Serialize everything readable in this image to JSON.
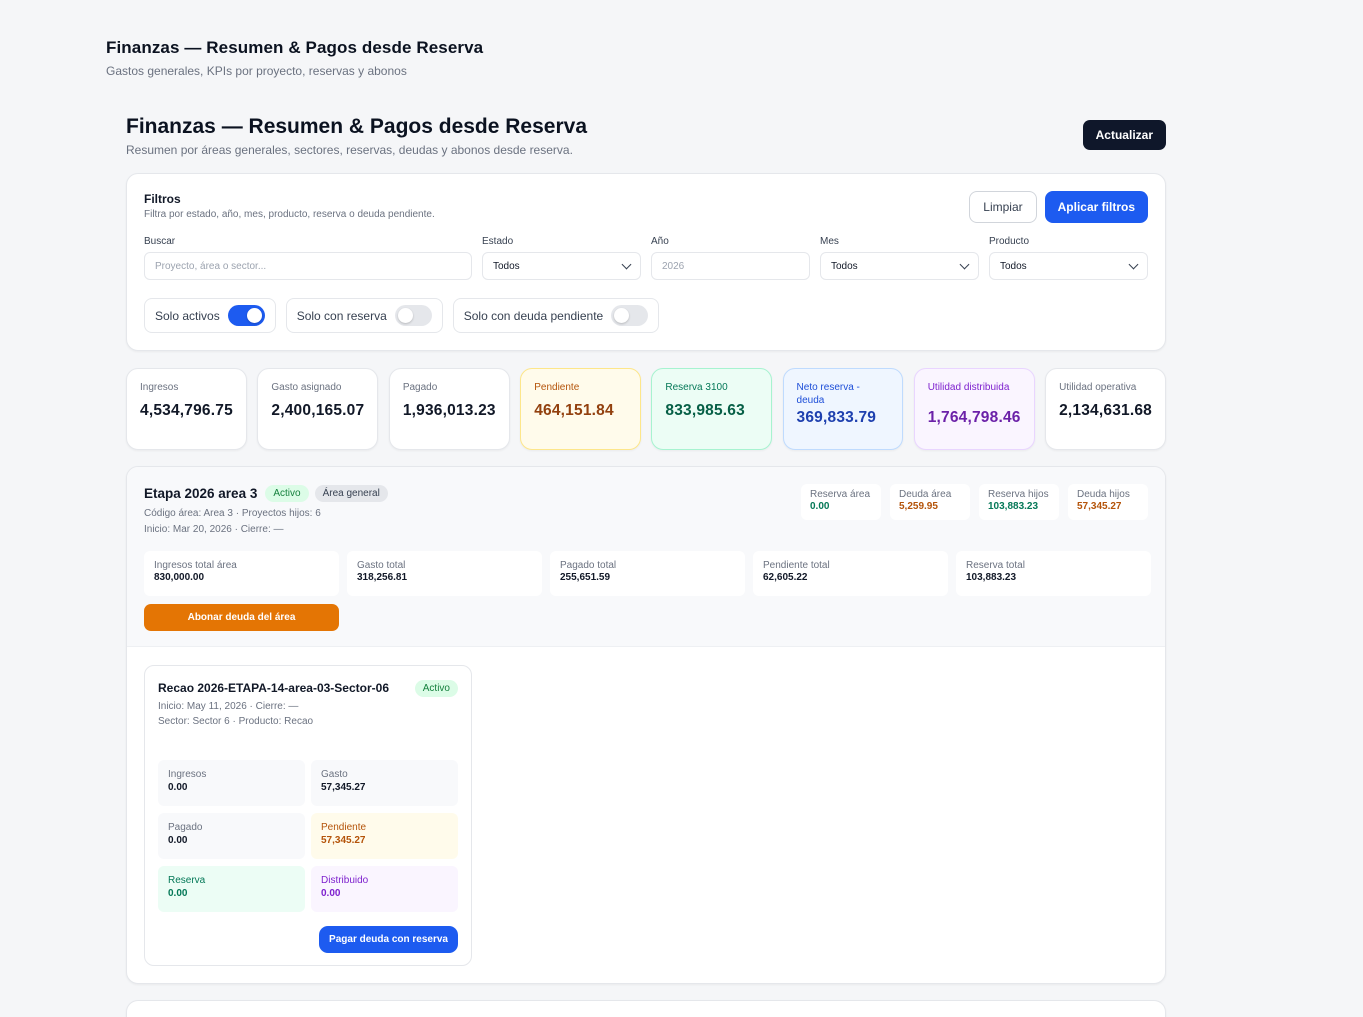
{
  "page": {
    "title": "Finanzas — Resumen & Pagos desde Reserva",
    "subtitle": "Gastos generales, KPIs por proyecto, reservas y abonos"
  },
  "main": {
    "title": "Finanzas — Resumen & Pagos desde Reserva",
    "subtitle": "Resumen por áreas generales, sectores, reservas, deudas y abonos desde reserva.",
    "refresh_label": "Actualizar"
  },
  "filters": {
    "title": "Filtros",
    "subtitle": "Filtra por estado, año, mes, producto, reserva o deuda pendiente.",
    "clear_label": "Limpiar",
    "apply_label": "Aplicar filtros",
    "search": {
      "label": "Buscar",
      "placeholder": "Proyecto, área o sector..."
    },
    "estado": {
      "label": "Estado",
      "value": "Todos"
    },
    "anio": {
      "label": "Año",
      "placeholder": "2026"
    },
    "mes": {
      "label": "Mes",
      "value": "Todos"
    },
    "producto": {
      "label": "Producto",
      "value": "Todos"
    },
    "toggles": [
      {
        "label": "Solo activos",
        "on": true
      },
      {
        "label": "Solo con reserva",
        "on": false
      },
      {
        "label": "Solo con deuda pendiente",
        "on": false
      }
    ]
  },
  "kpis": [
    {
      "label": "Ingresos",
      "value": "4,534,796.75"
    },
    {
      "label": "Gasto asignado",
      "value": "2,400,165.07"
    },
    {
      "label": "Pagado",
      "value": "1,936,013.23"
    },
    {
      "label": "Pendiente",
      "value": "464,151.84"
    },
    {
      "label": "Reserva 3100",
      "value": "833,985.63"
    },
    {
      "label": "Neto reserva - deuda",
      "value": "369,833.79"
    },
    {
      "label": "Utilidad distribuida",
      "value": "1,764,798.46"
    },
    {
      "label": "Utilidad operativa",
      "value": "2,134,631.68"
    }
  ],
  "area": {
    "title": "Etapa 2026 area 3",
    "status": "Activo",
    "type": "Área general",
    "meta_code": "Código área: Area 3 · Proyectos hijos: 6",
    "meta_dates": "Inicio: Mar 20, 2026 · Cierre: —",
    "mini": [
      {
        "label": "Reserva área",
        "value": "0.00"
      },
      {
        "label": "Deuda área",
        "value": "5,259.95"
      },
      {
        "label": "Reserva hijos",
        "value": "103,883.23"
      },
      {
        "label": "Deuda hijos",
        "value": "57,345.27"
      }
    ],
    "totals": [
      {
        "label": "Ingresos total área",
        "value": "830,000.00"
      },
      {
        "label": "Gasto total",
        "value": "318,256.81"
      },
      {
        "label": "Pagado total",
        "value": "255,651.59"
      },
      {
        "label": "Pendiente total",
        "value": "62,605.22"
      },
      {
        "label": "Reserva total",
        "value": "103,883.23"
      }
    ],
    "pay_area_label": "Abonar deuda del área"
  },
  "project": {
    "title": "Recao 2026-ETAPA-14-area-03-Sector-06",
    "status": "Activo",
    "meta_dates": "Inicio: May 11, 2026 · Cierre: —",
    "meta_sector": "Sector: Sector 6 · Producto: Recao",
    "cells": [
      {
        "label": "Ingresos",
        "value": "0.00"
      },
      {
        "label": "Gasto",
        "value": "57,345.27"
      },
      {
        "label": "Pagado",
        "value": "0.00"
      },
      {
        "label": "Pendiente",
        "value": "57,345.27"
      },
      {
        "label": "Reserva",
        "value": "0.00"
      },
      {
        "label": "Distribuido",
        "value": "0.00"
      }
    ],
    "pay_label": "Pagar deuda con reserva"
  }
}
